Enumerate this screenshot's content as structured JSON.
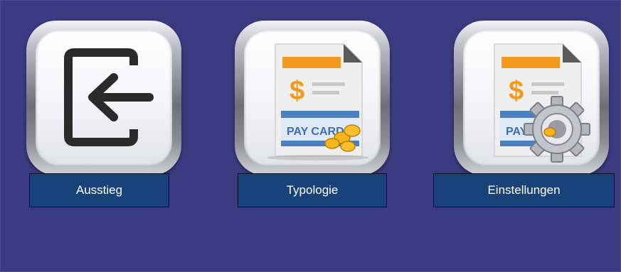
{
  "menu": {
    "items": [
      {
        "label": "Ausstieg",
        "icon": "exit-icon"
      },
      {
        "label": "Typologie",
        "icon": "pay-card-document-icon"
      },
      {
        "label": "Einstellungen",
        "icon": "pay-card-settings-icon"
      }
    ]
  },
  "icons": {
    "pay_card_text": "PAY CARD",
    "pay_card_text_partial": "PAY C"
  },
  "colors": {
    "background": "#3a3a80",
    "label_background": "#17427a",
    "label_text": "#ffffff",
    "accent_orange": "#f39a1e",
    "card_blue": "#4a7fc0"
  }
}
